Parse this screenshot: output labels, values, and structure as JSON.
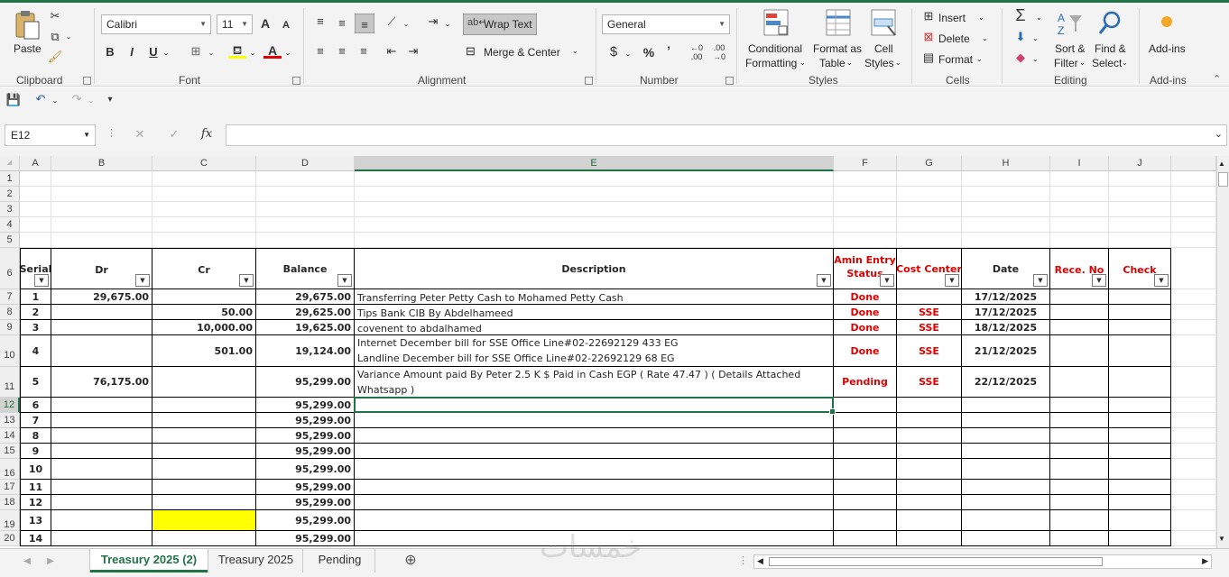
{
  "ribbon": {
    "clipboard": {
      "paste": "Paste",
      "label": "Clipboard"
    },
    "font": {
      "name": "Calibri",
      "size": "11",
      "bold": "B",
      "italic": "I",
      "underline": "U",
      "grow": "A",
      "shrink": "A",
      "label": "Font"
    },
    "alignment": {
      "wrap_text": "Wrap Text",
      "merge_center": "Merge & Center",
      "label": "Alignment"
    },
    "number": {
      "format": "General",
      "currency": "$",
      "percent": "%",
      "comma": "’",
      "label": "Number"
    },
    "styles": {
      "conditional_1": "Conditional",
      "conditional_2": "Formatting",
      "format_as_1": "Format as",
      "format_as_2": "Table",
      "cell_styles_1": "Cell",
      "cell_styles_2": "Styles",
      "label": "Styles"
    },
    "cells": {
      "insert": "Insert",
      "delete": "Delete",
      "format": "Format",
      "label": "Cells"
    },
    "editing": {
      "sort_1": "Sort &",
      "sort_2": "Filter",
      "find_1": "Find &",
      "find_2": "Select",
      "label": "Editing"
    },
    "addins": {
      "button": "Add-ins",
      "label": "Add-ins"
    }
  },
  "formula_bar": {
    "name_box": "E12",
    "fx": "fx",
    "value": ""
  },
  "columns": [
    {
      "letter": "A"
    },
    {
      "letter": "B"
    },
    {
      "letter": "C"
    },
    {
      "letter": "D"
    },
    {
      "letter": "E",
      "selected": true
    },
    {
      "letter": "F"
    },
    {
      "letter": "G"
    },
    {
      "letter": "H"
    },
    {
      "letter": "I"
    },
    {
      "letter": "J"
    }
  ],
  "rows": [
    "1",
    "2",
    "3",
    "4",
    "5",
    "6",
    "7",
    "8",
    "9",
    "10",
    "11",
    "12",
    "13",
    "14",
    "15",
    "16",
    "17",
    "18",
    "19",
    "20"
  ],
  "table_headers": {
    "serial": "Serial",
    "dr": "Dr",
    "cr": "Cr",
    "balance": "Balance",
    "description": "Description",
    "status_1": "Amin Entry",
    "status_2": "Status",
    "cost_center": "Cost Center",
    "date": "Date",
    "rece_no": "Rece. No",
    "check": "Check"
  },
  "table_rows": [
    {
      "serial": "1",
      "dr": "29,675.00",
      "cr": "",
      "balance": "29,675.00",
      "description": "Transferring Peter Petty Cash to Mohamed Petty Cash",
      "status": "Done",
      "cost_center": "",
      "date": "17/12/2025"
    },
    {
      "serial": "2",
      "dr": "",
      "cr": "50.00",
      "balance": "29,625.00",
      "description": "Tips Bank CIB By Abdelhameed",
      "status": "Done",
      "cost_center": "SSE",
      "date": "17/12/2025"
    },
    {
      "serial": "3",
      "dr": "",
      "cr": "10,000.00",
      "balance": "19,625.00",
      "description": "covenent to abdalhamed",
      "status": "Done",
      "cost_center": "SSE",
      "date": "18/12/2025"
    },
    {
      "serial": "4",
      "dr": "",
      "cr": "501.00",
      "balance": "19,124.00",
      "description": "Internet December bill for SSE Office Line#02-22692129    433 EG",
      "description_2": "Landline December bill for SSE Office Line#02-22692129     68 EG",
      "status": "Done",
      "cost_center": "SSE",
      "date": "21/12/2025"
    },
    {
      "serial": "5",
      "dr": "76,175.00",
      "cr": "",
      "balance": "95,299.00",
      "description": " Variance Amount paid By  Peter 2.5 K $ Paid in Cash EGP ( Rate 47.47 ) ( Details Attached",
      "description_2": "Whatsapp )",
      "status": "Pending",
      "cost_center": "SSE",
      "date": "22/12/2025"
    },
    {
      "serial": "6",
      "balance": "95,299.00"
    },
    {
      "serial": "7",
      "balance": "95,299.00"
    },
    {
      "serial": "8",
      "balance": "95,299.00"
    },
    {
      "serial": "9",
      "balance": "95,299.00"
    },
    {
      "serial": "10",
      "balance": "95,299.00"
    },
    {
      "serial": "11",
      "balance": "95,299.00"
    },
    {
      "serial": "12",
      "balance": "95,299.00"
    },
    {
      "serial": "13",
      "balance": "95,299.00"
    },
    {
      "serial": "14",
      "balance": "95,299.00"
    }
  ],
  "sheet_tabs": [
    "Treasury 2025 (2)",
    "Treasury 2025",
    "Pending"
  ],
  "active_tab": "Treasury 2025 (2)",
  "watermark": "خمسات",
  "colors": {
    "accent": "#217346",
    "status_red": "#e00000",
    "highlight": "#ffff00"
  }
}
